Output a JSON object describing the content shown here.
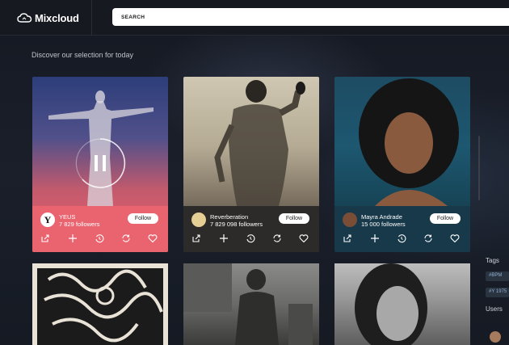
{
  "app": {
    "name": "Mixcloud",
    "colors": {
      "header_bg": "#16191f",
      "page_bg": "#141820",
      "accent_pink": "#ea6470"
    }
  },
  "search": {
    "placeholder": "SEARCH"
  },
  "main": {
    "section_title": "Discover our selection for today",
    "follow_label": "Follow",
    "cards": [
      {
        "name": "YEUS",
        "followers": "7 829 followers",
        "avatar_letter": "Y",
        "playing": true,
        "icons": [
          "share-icon",
          "plus-icon",
          "history-icon",
          "repost-icon",
          "heart-icon"
        ]
      },
      {
        "name": "Reverberation",
        "followers": "7 829 098 followers",
        "avatar_letter": "",
        "playing": false,
        "icons": [
          "share-icon",
          "plus-icon",
          "history-icon",
          "repost-icon",
          "heart-icon"
        ]
      },
      {
        "name": "Mayra Andrade",
        "followers": "15 000 followers",
        "avatar_letter": "",
        "playing": false,
        "icons": [
          "share-icon",
          "plus-icon",
          "history-icon",
          "repost-icon",
          "heart-icon"
        ]
      }
    ]
  },
  "sidebar": {
    "tags_title": "Tags",
    "tags": [
      "#BPM",
      "#Y 1975"
    ],
    "users_title": "Users"
  }
}
